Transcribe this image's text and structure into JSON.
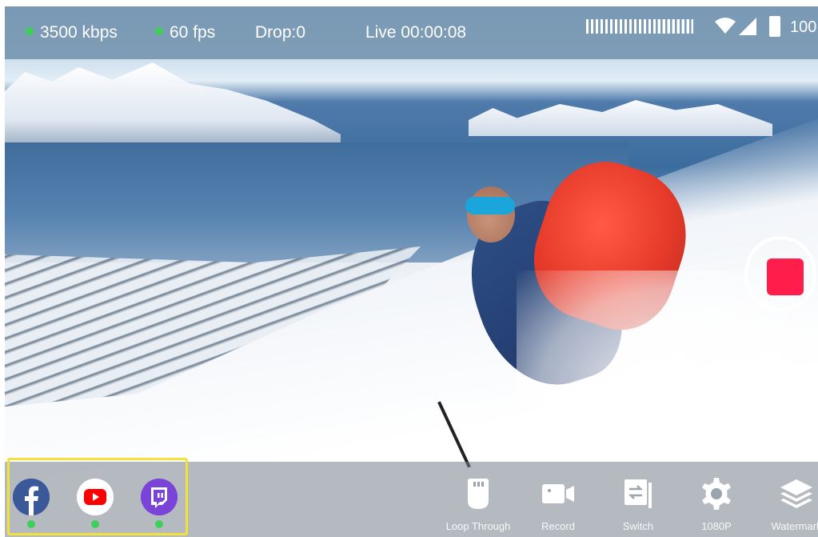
{
  "status_bar": {
    "bitrate": "3500 kbps",
    "fps": "60 fps",
    "drop": "Drop:0",
    "live": "Live 00:00:08",
    "battery": "100",
    "status_dot_color": "#3ecf5a"
  },
  "platforms": [
    {
      "name_icon": "facebook-icon",
      "color": "#3b5998",
      "status": "online"
    },
    {
      "name_icon": "youtube-icon",
      "color": "#ff0000",
      "status": "online"
    },
    {
      "name_icon": "twitch-icon",
      "color": "#9146ff",
      "status": "online"
    }
  ],
  "toolbar": {
    "loop_through": "Loop Through",
    "record": "Record",
    "switch": "Switch",
    "resolution": "1080P",
    "watermark": "Watermark"
  },
  "record_button": {
    "color": "#ff1e4b"
  },
  "highlight_color": "#f2e23a"
}
